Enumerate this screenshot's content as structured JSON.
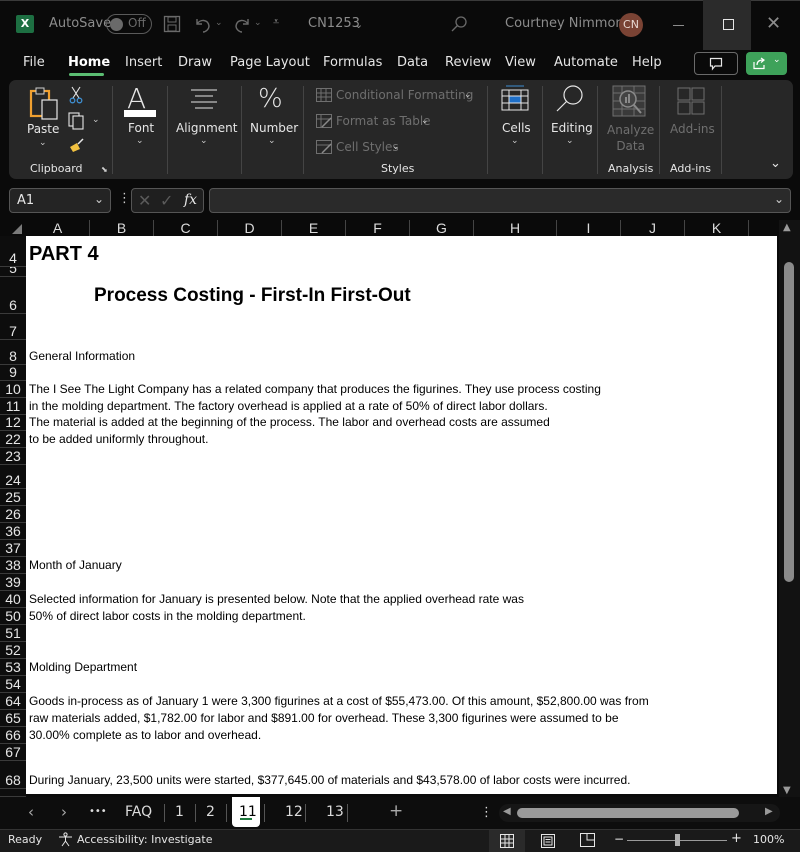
{
  "titlebar": {
    "app_icon": "excel-logo-icon",
    "autosave_label": "AutoSave",
    "autosave_state": "Off",
    "filename": "CN1253",
    "user_name": "Courtney Nimmons",
    "user_initials": "CN"
  },
  "menu": {
    "tabs": [
      "File",
      "Home",
      "Insert",
      "Draw",
      "Page Layout",
      "Formulas",
      "Data",
      "Review",
      "View",
      "Automate",
      "Help"
    ],
    "active": "Home"
  },
  "ribbon": {
    "clipboard": {
      "paste": "Paste",
      "group": "Clipboard"
    },
    "font": "Font",
    "alignment": "Alignment",
    "number": "Number",
    "styles": {
      "conditional_formatting": "Conditional Formatting",
      "format_as_table": "Format as Table",
      "cell_styles": "Cell Styles",
      "group": "Styles"
    },
    "cells": "Cells",
    "editing": "Editing",
    "analyze_data": [
      "Analyze",
      "Data"
    ],
    "analysis_group": "Analysis",
    "addins": "Add-ins",
    "addins_group": "Add-ins"
  },
  "formula_bar": {
    "name_box": "A1",
    "fx": "fx",
    "formula": ""
  },
  "columns": [
    "A",
    "B",
    "C",
    "D",
    "E",
    "F",
    "G",
    "H",
    "I",
    "J",
    "K"
  ],
  "rows": [
    {
      "num": "4",
      "text": "PART 4"
    },
    {
      "num": "5",
      "text": ""
    },
    {
      "num": "6",
      "text": "Process Costing - First-In First-Out"
    },
    {
      "num": "7",
      "text": ""
    },
    {
      "num": "8",
      "text": "General Information"
    },
    {
      "num": "9",
      "text": ""
    },
    {
      "num": "10",
      "text": "The I See The Light Company has a related company that produces the figurines.  They use process costing"
    },
    {
      "num": "11",
      "text": "in the molding department. The factory overhead is applied at a rate of 50% of direct labor dollars."
    },
    {
      "num": "12",
      "text": "The material is added at the beginning of the process.  The labor and overhead costs are assumed"
    },
    {
      "num": "22",
      "text": " to be added uniformly throughout."
    },
    {
      "num": "23",
      "text": ""
    },
    {
      "num": "24",
      "text": ""
    },
    {
      "num": "25",
      "text": ""
    },
    {
      "num": "26",
      "text": ""
    },
    {
      "num": "36",
      "text": ""
    },
    {
      "num": "37",
      "text": ""
    },
    {
      "num": "38",
      "text": "Month of January"
    },
    {
      "num": "39",
      "text": ""
    },
    {
      "num": "40",
      "text": "Selected information for January is presented below.  Note that the  applied overhead rate was"
    },
    {
      "num": "50",
      "text": "50% of direct labor costs in the molding department."
    },
    {
      "num": "51",
      "text": ""
    },
    {
      "num": "52",
      "text": ""
    },
    {
      "num": "53",
      "text": "Molding Department"
    },
    {
      "num": "54",
      "text": ""
    },
    {
      "num": "64",
      "text": "Goods in-process as of January 1 were 3,300 figurines at a cost of $55,473.00.  Of this amount, $52,800.00 was from"
    },
    {
      "num": "65",
      "text": "raw materials added, $1,782.00 for labor and $891.00 for overhead.  These 3,300 figurines were assumed to be"
    },
    {
      "num": "66",
      "text": "30.00% complete as to labor and overhead."
    },
    {
      "num": "67",
      "text": ""
    },
    {
      "num": "68",
      "text": "During January, 23,500 units were started, $377,645.00 of materials and $43,578.00 of labor costs were incurred."
    }
  ],
  "sheet_tabs": {
    "tabs": [
      "FAQ",
      "1",
      "2",
      "11",
      "12",
      "13"
    ],
    "active": "11",
    "more": "•••",
    "add": "+"
  },
  "status": {
    "ready": "Ready",
    "accessibility": "Accessibility: Investigate",
    "zoom": "100%",
    "zoom_fraction": 0.5
  }
}
